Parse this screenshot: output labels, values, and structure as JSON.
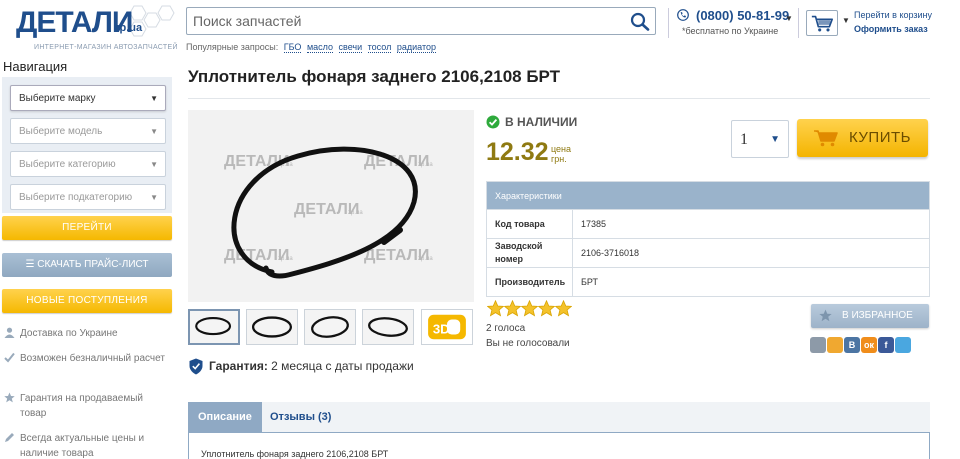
{
  "header": {
    "logo_main": "ДЕТАЛИ",
    "logo_zp": "zp.ua",
    "logo_sub": "ИНТЕРНЕТ-МАГАЗИН АВТОЗАПЧАСТЕЙ",
    "search_placeholder": "Поиск запчастей",
    "popular_label": "Популярные запросы:",
    "popular_tags": [
      "ГБО",
      "масло",
      "свечи",
      "тосол",
      "радиатор"
    ],
    "phone": "(0800) 50-81-99",
    "phone_sub": "*бесплатно по Украине",
    "cart_link": "Перейти в корзину",
    "cart_checkout": "Оформить заказ"
  },
  "sidebar": {
    "nav_title": "Навигация",
    "selects": [
      "Выберите марку",
      "Выберите модель",
      "Выберите категорию",
      "Выберите подкатегорию"
    ],
    "go_button": "ПЕРЕЙТИ",
    "price_list_button": "СКАЧАТЬ ПРАЙС-ЛИСТ",
    "new_arrivals_button": "НОВЫЕ ПОСТУПЛЕНИЯ",
    "features": [
      "Доставка по Украине",
      "Возможен безналичный расчет",
      "Гарантия на продаваемый товар",
      "Всегда актуальные цены и наличие товара"
    ]
  },
  "product": {
    "title": "Уплотнитель фонаря заднего 2106,2108 БРТ",
    "watermark": "ДЕТАЛИ",
    "watermark_zp": "zp.ua",
    "stock": "В НАЛИЧИИ",
    "price": "12.32",
    "price_label_1": "цена",
    "price_label_2": "грн.",
    "quantity": "1",
    "buy_label": "КУПИТЬ",
    "guarantee_label": "Гарантия:",
    "guarantee_text": "2 месяца с даты продажи",
    "thumb_3d": "3D",
    "rating": 5,
    "votes": "2 голоса",
    "not_voted": "Вы не голосовали",
    "favorite_label": "В ИЗБРАННОЕ",
    "share_icons": [
      "print-icon",
      "email-icon",
      "vk-icon",
      "odnoklassniki-icon",
      "facebook-icon",
      "twitter-icon"
    ],
    "share_letters": [
      "",
      "",
      "В",
      "ок",
      "f",
      ""
    ]
  },
  "specs": {
    "header": "Характеристики",
    "rows": [
      {
        "key": "Код товара",
        "value": "17385"
      },
      {
        "key": "Заводской номер",
        "value": "2106-3716018"
      },
      {
        "key": "Производитель",
        "value": "БРТ"
      }
    ]
  },
  "tabs": {
    "description": "Описание",
    "reviews": "Отзывы (3)",
    "content": "Уплотнитель фонаря заднего 2106,2108 БРТ"
  },
  "colors": {
    "brand_blue": "#1f4e8c",
    "accent_yellow": "#f5b800",
    "price_olive": "#8f7a12",
    "stock_green": "#2eaa3c",
    "table_header": "#9ab3cb"
  }
}
